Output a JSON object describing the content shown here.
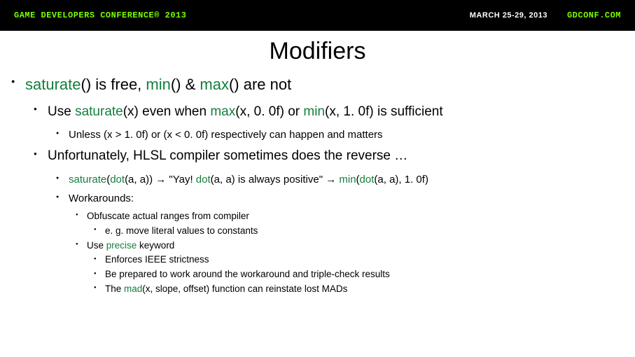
{
  "topbar": {
    "conference": "GAME DEVELOPERS CONFERENCE® 2013",
    "date": "MARCH 25-29, 2013",
    "site": "GDCONF.COM"
  },
  "title": "Modifiers",
  "kw": {
    "saturate": "saturate",
    "min": "min",
    "max": "max",
    "dot": "dot",
    "precise": "precise",
    "mad": "mad"
  },
  "t": {
    "p1a": "() is free, ",
    "p1b": "() & ",
    "p1c": "() are not",
    "p2a": "Use ",
    "p2b": "(x) even when ",
    "p2c": "(x, 0. 0f) or ",
    "p2d": "(x, 1. 0f) is sufficient",
    "p3": "Unless (x > 1. 0f) or (x < 0. 0f) respectively can happen and matters",
    "p4": "Unfortunately, HLSL compiler sometimes does the reverse …",
    "p5a": "(",
    "p5b": "(a, a)) → \"Yay! ",
    "p5c": "(a, a) is always positive\" → ",
    "p5d": "(",
    "p5e": "(a, a), 1. 0f)",
    "p6": "Workarounds:",
    "p7": "Obfuscate actual ranges from compiler",
    "p8": "e. g. move literal values to constants",
    "p9a": "Use ",
    "p9b": " keyword",
    "p10": "Enforces IEEE strictness",
    "p11": "Be prepared to work around the workaround and triple-check results",
    "p12a": "The ",
    "p12b": "(x, slope, offset) function can reinstate lost MADs"
  }
}
